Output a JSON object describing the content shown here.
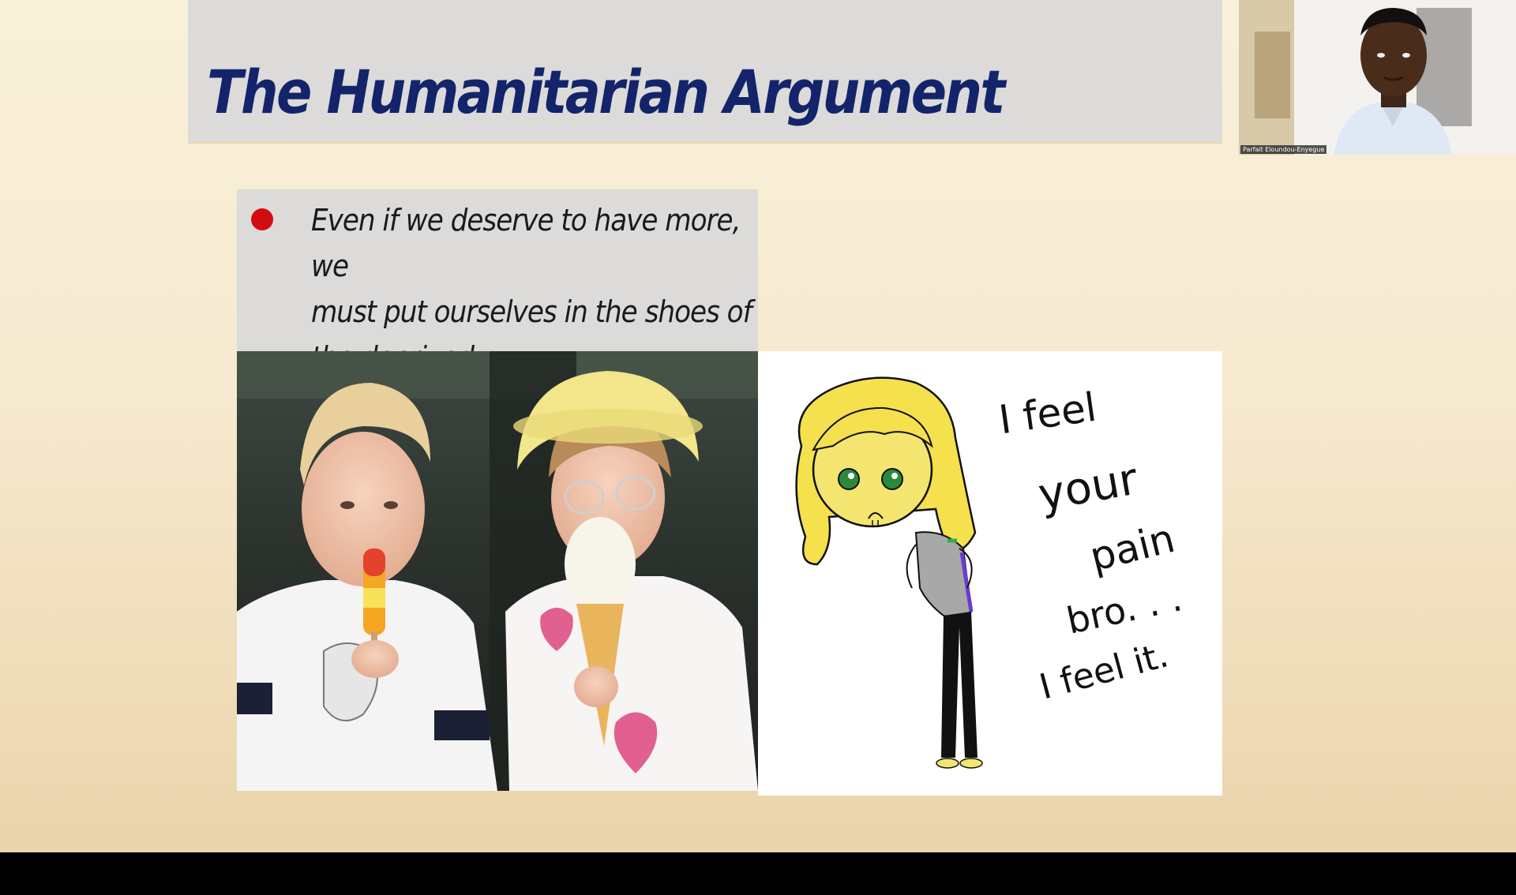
{
  "slide": {
    "title": "The Humanitarian Argument",
    "bullet": {
      "lines": [
        "Even if we deserve to have more, we",
        "must put ourselves in the shoes of",
        "the deprived ."
      ],
      "marker_color": "#d20d12"
    },
    "photo_icon": "children-eating-ice-cream-photo",
    "cartoon": {
      "icon": "sad-girl-cartoon",
      "caption": [
        "I feel",
        "your",
        "pain",
        "bro. . .",
        "I feel it."
      ]
    }
  },
  "webcam": {
    "participant_name": "Parfait Eloundou-Enyegue",
    "icon": "participant-video"
  },
  "colors": {
    "title": "#14246b",
    "title_bar": "#dcdbd9",
    "background": "#f6ead0"
  }
}
